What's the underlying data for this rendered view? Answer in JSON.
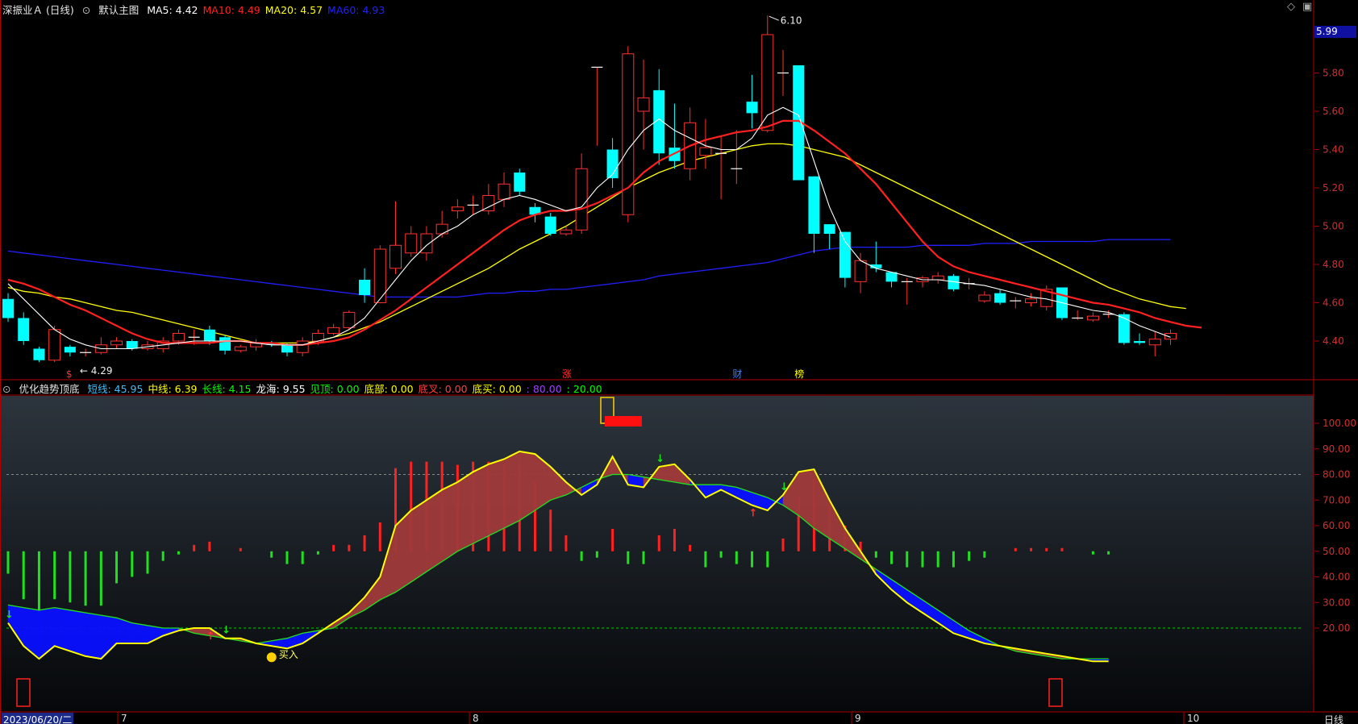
{
  "main_panel": {
    "title": "深振业Ａ (日线)",
    "template": "默认主图",
    "ma_labels": [
      {
        "text": "MA5: 4.42",
        "color": "#ffffff"
      },
      {
        "text": "MA10: 4.49",
        "color": "#ff2020"
      },
      {
        "text": "MA20: 4.57",
        "color": "#ffff00"
      },
      {
        "text": "MA60: 4.93",
        "color": "#2020ff"
      }
    ],
    "high_label": "6.10",
    "low_label": "4.29",
    "current_price": "5.99",
    "event_markers": [
      {
        "text": "$",
        "color": "#ff3030"
      },
      {
        "text": "涨",
        "color": "#ff3030"
      },
      {
        "text": "财",
        "color": "#4080ff"
      },
      {
        "text": "榜",
        "color": "#ffff00"
      }
    ],
    "top_icons": [
      "diamond-icon",
      "window-icon"
    ]
  },
  "sub_panel": {
    "title": "优化趋势顶底",
    "labels": [
      {
        "text": "短线: 45.95",
        "color": "#40c0ff"
      },
      {
        "text": "中线: 6.39",
        "color": "#ffff00"
      },
      {
        "text": "长线: 4.15",
        "color": "#00ff00"
      },
      {
        "text": "龙海: 9.55",
        "color": "#ffffff"
      },
      {
        "text": "见顶: 0.00",
        "color": "#00ff00"
      },
      {
        "text": "底部: 0.00",
        "color": "#ffff00"
      },
      {
        "text": "底叉: 0.00",
        "color": "#ff4040"
      },
      {
        "text": "底买: 0.00",
        "color": "#ffff00"
      },
      {
        "text": ": 80.00",
        "color": "#a040ff"
      },
      {
        "text": ": 20.00",
        "color": "#00ff00"
      }
    ],
    "buy_label": "买入"
  },
  "date_axis": {
    "first_date": "2023/06/20/二",
    "months": [
      "7",
      "8",
      "9",
      "10"
    ],
    "period": "日线"
  },
  "colors": {
    "up": "#ff3030",
    "down": "#00ffff",
    "ma5": "#ffffff",
    "ma10": "#ff2020",
    "ma20": "#ffff00",
    "ma60": "#2020ff",
    "axis": "#b00000",
    "fill_up": "#a03a3a",
    "fill_down": "#0a10ff"
  },
  "chart_data": [
    {
      "type": "candlestick",
      "title": "深振业Ａ (日线)",
      "ylim": [
        4.25,
        6.2
      ],
      "yticks": [
        "6.00",
        "5.80",
        "5.60",
        "5.40",
        "5.20",
        "5.00",
        "4.80",
        "4.60",
        "4.40"
      ],
      "candles": [
        [
          4.62,
          4.52,
          4.65,
          4.5
        ],
        [
          4.52,
          4.4,
          4.55,
          4.38
        ],
        [
          4.36,
          4.3,
          4.37,
          4.29
        ],
        [
          4.3,
          4.46,
          4.48,
          4.29
        ],
        [
          4.37,
          4.34,
          4.38,
          4.32
        ],
        [
          4.34,
          4.34,
          4.36,
          4.32
        ],
        [
          4.34,
          4.38,
          4.42,
          4.33
        ],
        [
          4.38,
          4.4,
          4.42,
          4.36
        ],
        [
          4.4,
          4.36,
          4.41,
          4.35
        ],
        [
          4.36,
          4.38,
          4.4,
          4.35
        ],
        [
          4.36,
          4.4,
          4.42,
          4.34
        ],
        [
          4.4,
          4.44,
          4.46,
          4.38
        ],
        [
          4.42,
          4.42,
          4.46,
          4.38
        ],
        [
          4.46,
          4.4,
          4.48,
          4.38
        ],
        [
          4.42,
          4.35,
          4.43,
          4.33
        ],
        [
          4.35,
          4.37,
          4.38,
          4.34
        ],
        [
          4.37,
          4.39,
          4.41,
          4.35
        ],
        [
          4.39,
          4.38,
          4.4,
          4.37
        ],
        [
          4.38,
          4.34,
          4.39,
          4.32
        ],
        [
          4.34,
          4.4,
          4.42,
          4.32
        ],
        [
          4.4,
          4.44,
          4.46,
          4.38
        ],
        [
          4.44,
          4.47,
          4.49,
          4.43
        ],
        [
          4.47,
          4.55,
          4.56,
          4.46
        ],
        [
          4.72,
          4.64,
          4.78,
          4.6
        ],
        [
          4.6,
          4.88,
          4.9,
          4.6
        ],
        [
          4.78,
          4.9,
          5.13,
          4.75
        ],
        [
          4.86,
          4.96,
          5.0,
          4.84
        ],
        [
          4.86,
          4.96,
          5.0,
          4.82
        ],
        [
          4.96,
          5.01,
          5.08,
          4.94
        ],
        [
          5.08,
          5.1,
          5.14,
          5.04
        ],
        [
          5.11,
          5.11,
          5.16,
          5.06
        ],
        [
          5.08,
          5.16,
          5.22,
          5.06
        ],
        [
          5.14,
          5.22,
          5.28,
          5.1
        ],
        [
          5.28,
          5.18,
          5.3,
          5.16
        ],
        [
          5.1,
          5.06,
          5.12,
          5.02
        ],
        [
          5.05,
          4.96,
          5.07,
          4.95
        ],
        [
          4.96,
          4.98,
          5.0,
          4.95
        ],
        [
          4.98,
          5.3,
          5.38,
          4.96
        ],
        [
          5.83,
          5.83,
          5.83,
          5.42
        ],
        [
          5.4,
          5.25,
          5.46,
          5.2
        ],
        [
          5.06,
          5.9,
          5.94,
          5.02
        ],
        [
          5.6,
          5.67,
          5.87,
          5.4
        ],
        [
          5.71,
          5.38,
          5.82,
          5.32
        ],
        [
          5.41,
          5.34,
          5.64,
          5.3
        ],
        [
          5.3,
          5.54,
          5.62,
          5.24
        ],
        [
          5.37,
          5.41,
          5.56,
          5.3
        ],
        [
          5.38,
          5.38,
          5.47,
          5.14
        ],
        [
          5.3,
          5.3,
          5.5,
          5.22
        ],
        [
          5.65,
          5.59,
          5.79,
          5.51
        ],
        [
          5.5,
          6.0,
          6.1,
          5.49
        ],
        [
          5.8,
          5.8,
          5.92,
          5.68
        ],
        [
          5.84,
          5.24,
          5.84,
          5.24
        ],
        [
          5.26,
          4.96,
          5.26,
          4.86
        ],
        [
          5.01,
          4.96,
          5.01,
          4.88
        ],
        [
          4.97,
          4.73,
          4.97,
          4.68
        ],
        [
          4.71,
          4.82,
          4.86,
          4.65
        ],
        [
          4.8,
          4.78,
          4.92,
          4.76
        ],
        [
          4.76,
          4.71,
          4.76,
          4.68
        ],
        [
          4.71,
          4.71,
          4.73,
          4.59
        ],
        [
          4.71,
          4.73,
          4.74,
          4.68
        ],
        [
          4.72,
          4.74,
          4.76,
          4.7
        ],
        [
          4.74,
          4.67,
          4.75,
          4.66
        ],
        [
          4.7,
          4.7,
          4.73,
          4.67
        ],
        [
          4.61,
          4.64,
          4.66,
          4.6
        ],
        [
          4.65,
          4.6,
          4.67,
          4.59
        ],
        [
          4.61,
          4.61,
          4.63,
          4.57
        ],
        [
          4.6,
          4.62,
          4.65,
          4.58
        ],
        [
          4.58,
          4.67,
          4.69,
          4.56
        ],
        [
          4.68,
          4.52,
          4.68,
          4.51
        ],
        [
          4.52,
          4.52,
          4.56,
          4.51
        ],
        [
          4.51,
          4.53,
          4.55,
          4.5
        ],
        [
          4.54,
          4.54,
          4.56,
          4.52
        ],
        [
          4.54,
          4.39,
          4.55,
          4.38
        ],
        [
          4.4,
          4.39,
          4.44,
          4.38
        ],
        [
          4.38,
          4.41,
          4.45,
          4.32
        ],
        [
          4.41,
          4.44,
          4.46,
          4.38
        ]
      ],
      "ma5": [
        4.7,
        4.62,
        4.54,
        4.46,
        4.41,
        4.38,
        4.36,
        4.36,
        4.36,
        4.37,
        4.38,
        4.39,
        4.4,
        4.4,
        4.4,
        4.4,
        4.39,
        4.38,
        4.38,
        4.38,
        4.4,
        4.42,
        4.46,
        4.52,
        4.62,
        4.72,
        4.82,
        4.9,
        4.96,
        5.0,
        5.06,
        5.1,
        5.14,
        5.16,
        5.14,
        5.11,
        5.08,
        5.1,
        5.2,
        5.27,
        5.4,
        5.5,
        5.56,
        5.5,
        5.46,
        5.42,
        5.4,
        5.4,
        5.46,
        5.58,
        5.62,
        5.58,
        5.34,
        5.1,
        4.92,
        4.82,
        4.78,
        4.76,
        4.74,
        4.72,
        4.72,
        4.71,
        4.7,
        4.69,
        4.67,
        4.65,
        4.63,
        4.62,
        4.6,
        4.58,
        4.56,
        4.55,
        4.52,
        4.48,
        4.45,
        4.42
      ],
      "ma10": [
        4.72,
        4.7,
        4.67,
        4.63,
        4.59,
        4.56,
        4.52,
        4.48,
        4.44,
        4.41,
        4.39,
        4.39,
        4.39,
        4.39,
        4.4,
        4.4,
        4.39,
        4.39,
        4.38,
        4.38,
        4.39,
        4.4,
        4.42,
        4.46,
        4.51,
        4.56,
        4.62,
        4.68,
        4.74,
        4.8,
        4.86,
        4.92,
        4.98,
        5.03,
        5.06,
        5.08,
        5.08,
        5.09,
        5.12,
        5.16,
        5.2,
        5.28,
        5.34,
        5.38,
        5.42,
        5.45,
        5.47,
        5.49,
        5.5,
        5.52,
        5.55,
        5.55,
        5.5,
        5.44,
        5.38,
        5.3,
        5.22,
        5.12,
        5.02,
        4.92,
        4.84,
        4.79,
        4.76,
        4.74,
        4.72,
        4.7,
        4.68,
        4.66,
        4.64,
        4.62,
        4.6,
        4.59,
        4.57,
        4.55,
        4.52,
        4.5,
        4.48,
        4.47
      ],
      "ma20": [
        4.68,
        4.66,
        4.65,
        4.63,
        4.62,
        4.6,
        4.58,
        4.56,
        4.55,
        4.53,
        4.51,
        4.49,
        4.47,
        4.45,
        4.43,
        4.41,
        4.39,
        4.39,
        4.39,
        4.39,
        4.4,
        4.42,
        4.44,
        4.47,
        4.5,
        4.54,
        4.58,
        4.62,
        4.66,
        4.7,
        4.74,
        4.78,
        4.83,
        4.88,
        4.92,
        4.96,
        5.0,
        5.05,
        5.1,
        5.15,
        5.2,
        5.24,
        5.28,
        5.31,
        5.34,
        5.36,
        5.38,
        5.4,
        5.42,
        5.43,
        5.43,
        5.42,
        5.4,
        5.38,
        5.36,
        5.32,
        5.28,
        5.24,
        5.2,
        5.16,
        5.12,
        5.08,
        5.04,
        5.0,
        4.96,
        4.92,
        4.88,
        4.84,
        4.8,
        4.76,
        4.72,
        4.68,
        4.65,
        4.62,
        4.6,
        4.58,
        4.57
      ],
      "ma60": [
        4.87,
        4.86,
        4.85,
        4.84,
        4.83,
        4.82,
        4.81,
        4.8,
        4.79,
        4.78,
        4.77,
        4.76,
        4.75,
        4.74,
        4.73,
        4.72,
        4.71,
        4.7,
        4.69,
        4.68,
        4.67,
        4.66,
        4.65,
        4.64,
        4.63,
        4.63,
        4.63,
        4.63,
        4.63,
        4.63,
        4.64,
        4.65,
        4.65,
        4.66,
        4.66,
        4.67,
        4.67,
        4.68,
        4.69,
        4.7,
        4.71,
        4.72,
        4.74,
        4.75,
        4.76,
        4.77,
        4.78,
        4.79,
        4.8,
        4.81,
        4.83,
        4.85,
        4.87,
        4.88,
        4.89,
        4.89,
        4.89,
        4.89,
        4.89,
        4.9,
        4.9,
        4.9,
        4.9,
        4.91,
        4.91,
        4.91,
        4.92,
        4.92,
        4.92,
        4.92,
        4.92,
        4.93,
        4.93,
        4.93,
        4.93,
        4.93
      ]
    },
    {
      "type": "indicator",
      "title": "优化趋势顶底",
      "ylim": [
        0,
        110
      ],
      "yticks": [
        "100.00",
        "90.00",
        "80.00",
        "70.00",
        "60.00",
        "50.00",
        "40.00",
        "30.00",
        "20.00"
      ],
      "reference_lines": [
        80,
        20
      ],
      "fast": [
        22,
        13,
        8,
        13,
        11,
        9,
        8,
        14,
        14,
        14,
        17,
        19,
        20,
        20,
        16,
        16,
        14,
        13,
        12,
        14,
        18,
        22,
        26,
        32,
        40,
        60,
        66,
        70,
        74,
        77,
        81,
        84,
        86,
        89,
        88,
        83,
        77,
        72,
        76,
        87,
        76,
        75,
        83,
        84,
        78,
        71,
        74,
        71,
        68,
        66,
        72,
        81,
        82,
        70,
        59,
        50,
        41,
        35,
        30,
        26,
        22,
        18,
        16,
        14,
        13,
        12,
        11,
        10,
        9,
        8,
        7,
        7,
        7,
        8,
        7,
        7,
        7,
        7,
        7,
        7,
        7,
        8,
        9
      ],
      "slow": [
        29,
        28,
        27,
        28,
        27,
        26,
        25,
        24,
        22,
        21,
        20,
        20,
        18,
        17,
        16,
        15,
        14,
        15,
        16,
        18,
        19,
        20,
        24,
        27,
        31,
        34,
        38,
        42,
        46,
        50,
        53,
        56,
        59,
        62,
        66,
        70,
        72,
        75,
        78,
        80,
        80,
        79,
        78,
        77,
        76,
        76,
        76,
        75,
        73,
        71,
        68,
        64,
        59,
        55,
        51,
        47,
        43,
        39,
        35,
        31,
        27,
        23,
        19,
        16,
        13,
        11,
        10,
        9,
        8,
        8,
        8,
        8
      ]
    }
  ]
}
